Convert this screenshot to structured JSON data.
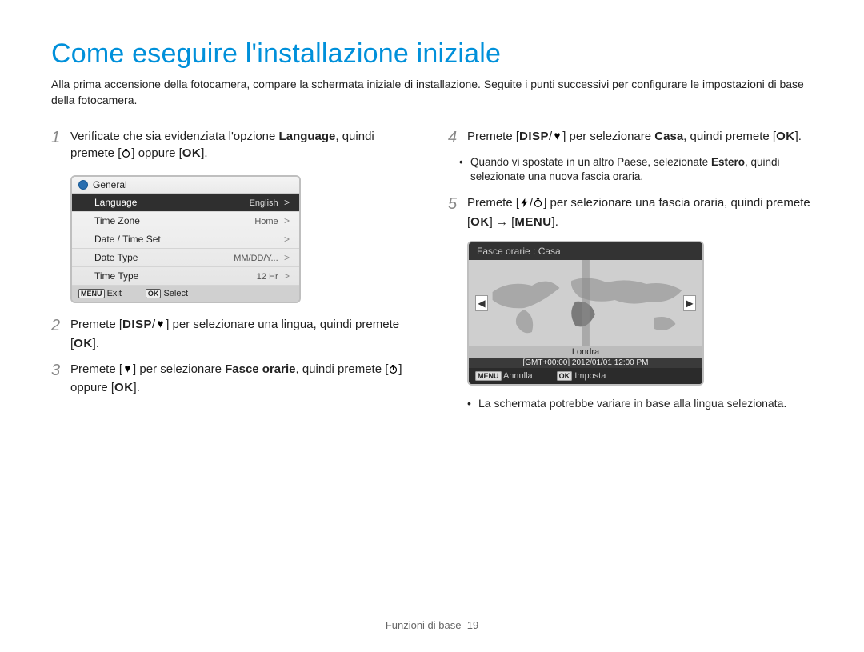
{
  "page_title": "Come eseguire l'installazione iniziale",
  "intro": "Alla prima accensione della fotocamera, compare la schermata iniziale di installazione. Seguite i punti successivi per configurare le impostazioni di base della fotocamera.",
  "steps": {
    "s1": {
      "num": "1",
      "pre": "Verificate che sia evidenziata l'opzione ",
      "bold": "Language",
      "mid": ", quindi premete [",
      "tail": "] oppure ["
    },
    "s2": {
      "num": "2",
      "pre": "Premete [",
      "disp": "DISP",
      "mid": "] per selezionare una lingua, quindi premete ["
    },
    "s3": {
      "num": "3",
      "pre": "Premete [",
      "mid": "] per selezionare ",
      "bold": "Fasce orarie",
      "post": ", quindi premete [",
      "tail": "] oppure ["
    },
    "s4": {
      "num": "4",
      "pre": "Premete [",
      "disp": "DISP",
      "mid": "] per selezionare ",
      "bold": "Casa",
      "post": ", quindi premete ["
    },
    "s4_note": {
      "pre": "Quando vi spostate in un altro Paese, selezionate ",
      "bold": "Estero",
      "post": ", quindi selezionate una nuova fascia oraria."
    },
    "s5": {
      "num": "5",
      "pre": "Premete [",
      "mid": "] per selezionare una fascia oraria, quindi premete [",
      "arrow": "→",
      "menu": "MENU"
    }
  },
  "key_ok": "OK",
  "cam_screen": {
    "header": "General",
    "rows": [
      {
        "label": "Language",
        "value": "English",
        "selected": true
      },
      {
        "label": "Time Zone",
        "value": "Home",
        "selected": false
      },
      {
        "label": "Date / Time Set",
        "value": "",
        "selected": false
      },
      {
        "label": "Date Type",
        "value": "MM/DD/Y...",
        "selected": false
      },
      {
        "label": "Time Type",
        "value": "12 Hr",
        "selected": false
      }
    ],
    "footer_left_key": "MENU",
    "footer_left": "Exit",
    "footer_right_key": "OK",
    "footer_right": "Select"
  },
  "tz_screen": {
    "header": "Fasce orarie : Casa",
    "city": "Londra",
    "time": "[GMT+00:00] 2012/01/01 12:00 PM",
    "footer_left_key": "MENU",
    "footer_left": "Annulla",
    "footer_right_key": "OK",
    "footer_right": "Imposta"
  },
  "final_note": "La schermata potrebbe variare in base alla lingua selezionata.",
  "footer_section": "Funzioni di base",
  "footer_page": "19"
}
